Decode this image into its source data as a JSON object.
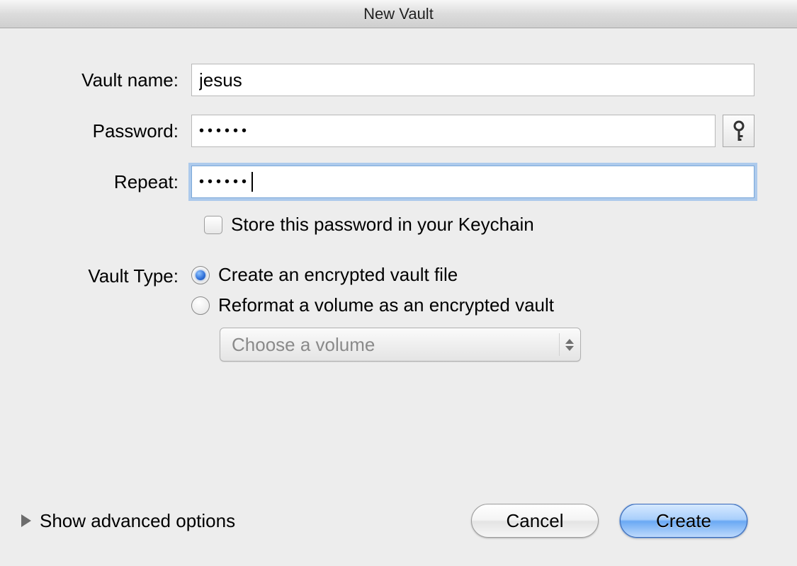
{
  "window": {
    "title": "New Vault"
  },
  "form": {
    "vault_name_label": "Vault name:",
    "vault_name_value": "jesus",
    "password_label": "Password:",
    "password_value": "••••••",
    "repeat_label": "Repeat:",
    "repeat_value": "••••••",
    "keychain_checkbox_label": "Store this password in your Keychain",
    "keychain_checked": false
  },
  "vault_type": {
    "label": "Vault Type:",
    "option_file": "Create an encrypted vault file",
    "option_volume": "Reformat a volume as an encrypted vault",
    "selected": "file",
    "volume_popup": "Choose a volume"
  },
  "footer": {
    "advanced_label": "Show advanced options",
    "cancel": "Cancel",
    "create": "Create"
  }
}
